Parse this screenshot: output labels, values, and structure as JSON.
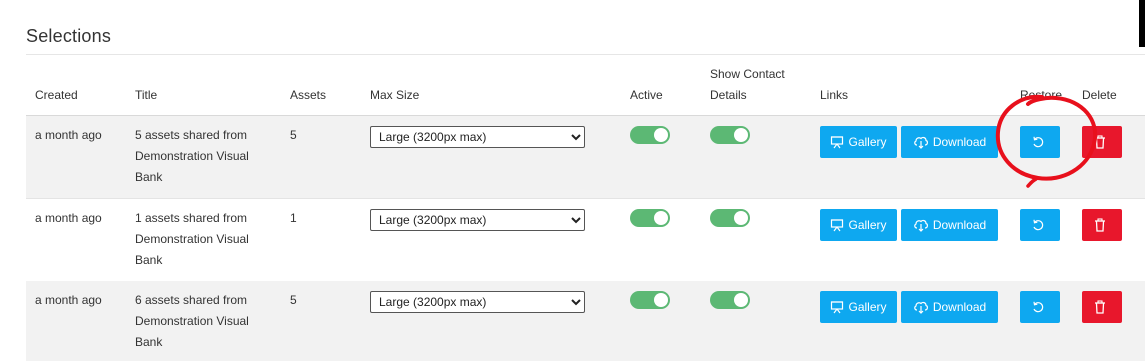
{
  "section_title": "Selections",
  "columns": {
    "created": "Created",
    "title": "Title",
    "assets": "Assets",
    "max_size": "Max Size",
    "active": "Active",
    "show_contact_line1": "Show Contact",
    "show_contact_line2": "Details",
    "links": "Links",
    "restore": "Restore",
    "delete": "Delete"
  },
  "buttons": {
    "gallery": "Gallery",
    "download": "Download"
  },
  "icons": {
    "gallery": "presentation-icon",
    "download": "cloud-download-icon",
    "restore": "restore-icon",
    "delete": "trash-icon"
  },
  "colors": {
    "accent": "#0ea8f0",
    "danger": "#e8172c",
    "toggle_on": "#5cb874",
    "annotation": "#e8101c"
  },
  "rows": [
    {
      "created": "a month ago",
      "title_lines": [
        "5 assets shared from",
        "Demonstration Visual",
        "Bank"
      ],
      "assets": "5",
      "max_size": "Large (3200px max)",
      "active": true,
      "show_contact": true
    },
    {
      "created": "a month ago",
      "title_lines": [
        "1 assets shared from",
        "Demonstration Visual",
        "Bank"
      ],
      "assets": "1",
      "max_size": "Large (3200px max)",
      "active": true,
      "show_contact": true
    },
    {
      "created": "a month ago",
      "title_lines": [
        "6 assets shared from",
        "Demonstration Visual",
        "Bank"
      ],
      "assets": "5",
      "max_size": "Large (3200px max)",
      "active": true,
      "show_contact": true
    }
  ]
}
